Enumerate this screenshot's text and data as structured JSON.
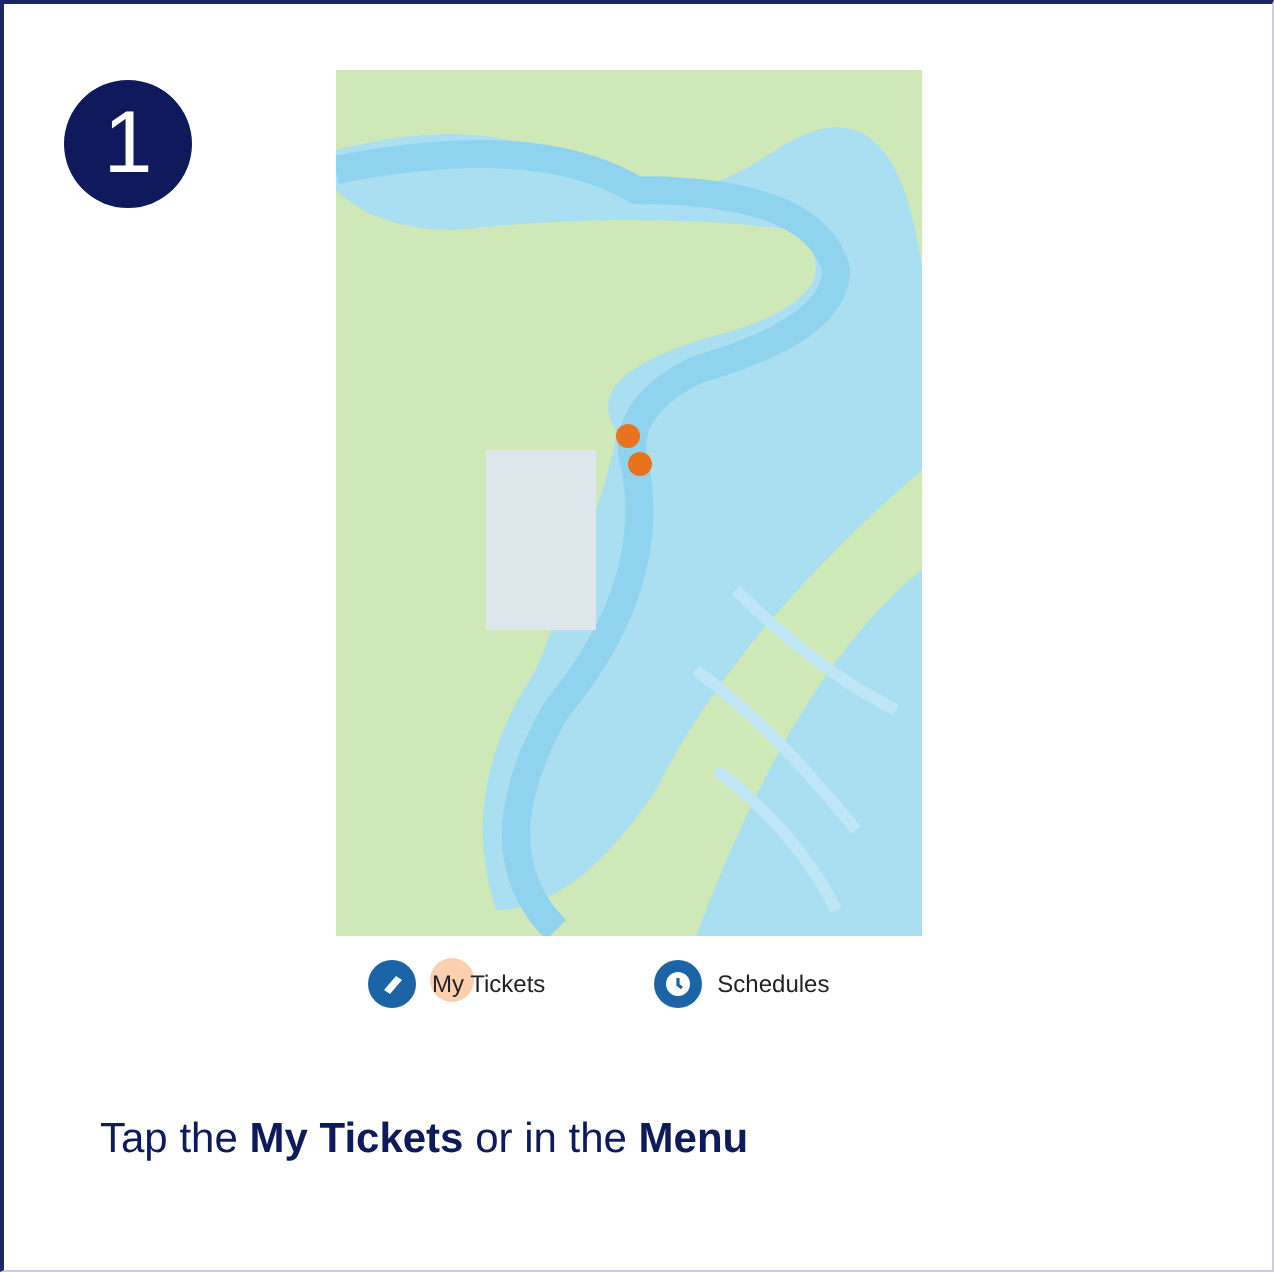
{
  "step": {
    "number": "1"
  },
  "nav": [
    {
      "label": "My Tickets",
      "kind": "ticket",
      "tapped": true
    },
    {
      "label": "Schedules",
      "kind": "clock",
      "tapped": false
    }
  ],
  "instruction": "Tap the **My Tickets** or in the **Menu**"
}
